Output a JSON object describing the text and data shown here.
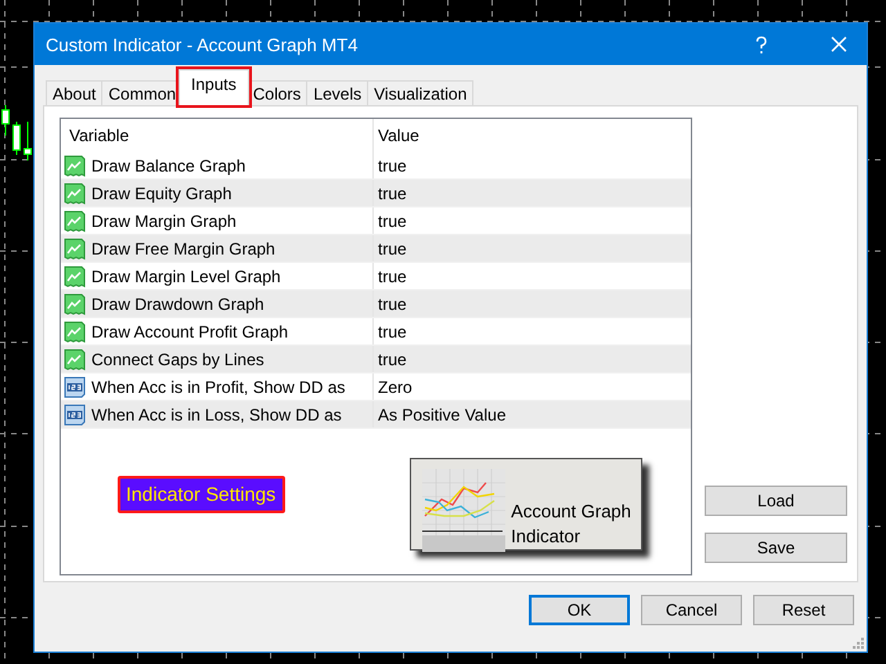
{
  "window": {
    "title": "Custom Indicator - Account Graph MT4"
  },
  "tabs": [
    {
      "label": "About",
      "selected": false,
      "highlighted": false
    },
    {
      "label": "Common",
      "selected": false,
      "highlighted": false
    },
    {
      "label": "Inputs",
      "selected": true,
      "highlighted": true
    },
    {
      "label": "Colors",
      "selected": false,
      "highlighted": false
    },
    {
      "label": "Levels",
      "selected": false,
      "highlighted": false
    },
    {
      "label": "Visualization",
      "selected": false,
      "highlighted": false
    }
  ],
  "table": {
    "columns": [
      "Variable",
      "Value"
    ],
    "rows": [
      {
        "kind": "bool",
        "variable": "Draw Balance Graph",
        "value": "true"
      },
      {
        "kind": "bool",
        "variable": "Draw Equity Graph",
        "value": "true"
      },
      {
        "kind": "bool",
        "variable": "Draw Margin Graph",
        "value": "true"
      },
      {
        "kind": "bool",
        "variable": "Draw Free Margin Graph",
        "value": "true"
      },
      {
        "kind": "bool",
        "variable": "Draw Margin Level Graph",
        "value": "true"
      },
      {
        "kind": "bool",
        "variable": "Draw Drawdown Graph",
        "value": "true"
      },
      {
        "kind": "bool",
        "variable": "Draw Account Profit Graph",
        "value": "true"
      },
      {
        "kind": "bool",
        "variable": "Connect Gaps by Lines",
        "value": "true"
      },
      {
        "kind": "number",
        "variable": "When Acc is in Profit, Show DD as",
        "value": "Zero"
      },
      {
        "kind": "number",
        "variable": "When Acc is in Loss, Show DD as",
        "value": "As Positive Value"
      }
    ]
  },
  "settings_label": "Indicator Settings",
  "banner": {
    "title": "Account Graph Indicator"
  },
  "side_buttons": [
    "Load",
    "Save"
  ],
  "buttons": [
    {
      "label": "OK",
      "default": true
    },
    {
      "label": "Cancel",
      "default": false
    },
    {
      "label": "Reset",
      "default": false
    }
  ]
}
